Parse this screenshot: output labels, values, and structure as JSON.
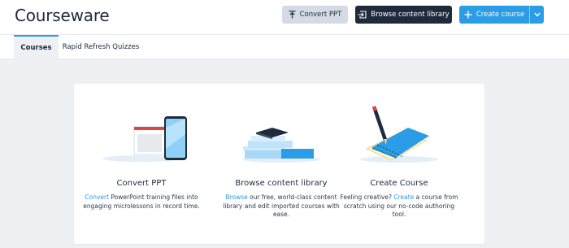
{
  "header": {
    "title": "Courseware",
    "convert_label": "Convert PPT",
    "browse_label": "Browse content library",
    "create_label": "Create course"
  },
  "tabs": [
    {
      "label": "Courses",
      "active": true
    },
    {
      "label": "Rapid Refresh Quizzes",
      "active": false
    }
  ],
  "options": [
    {
      "title": "Convert PPT",
      "link": "Convert",
      "text": " PowerPoint training files into engaging microlessons in record time."
    },
    {
      "title": "Browse content library",
      "link": "Browse",
      "text": " our free, world-class content library and edit imported courses with ease."
    },
    {
      "title": "Create Course",
      "text_before": "Feeling creative? ",
      "link": "Create",
      "text": " a course from scratch using our no-code authoring tool."
    }
  ],
  "colors": {
    "accent": "#2b9ce6",
    "dark_button": "#1f2a3c",
    "light_button": "#d5dbe4",
    "background": "#eef0f4"
  },
  "icons": [
    "upload-icon",
    "import-icon",
    "plus-icon",
    "chevron-down-icon"
  ]
}
